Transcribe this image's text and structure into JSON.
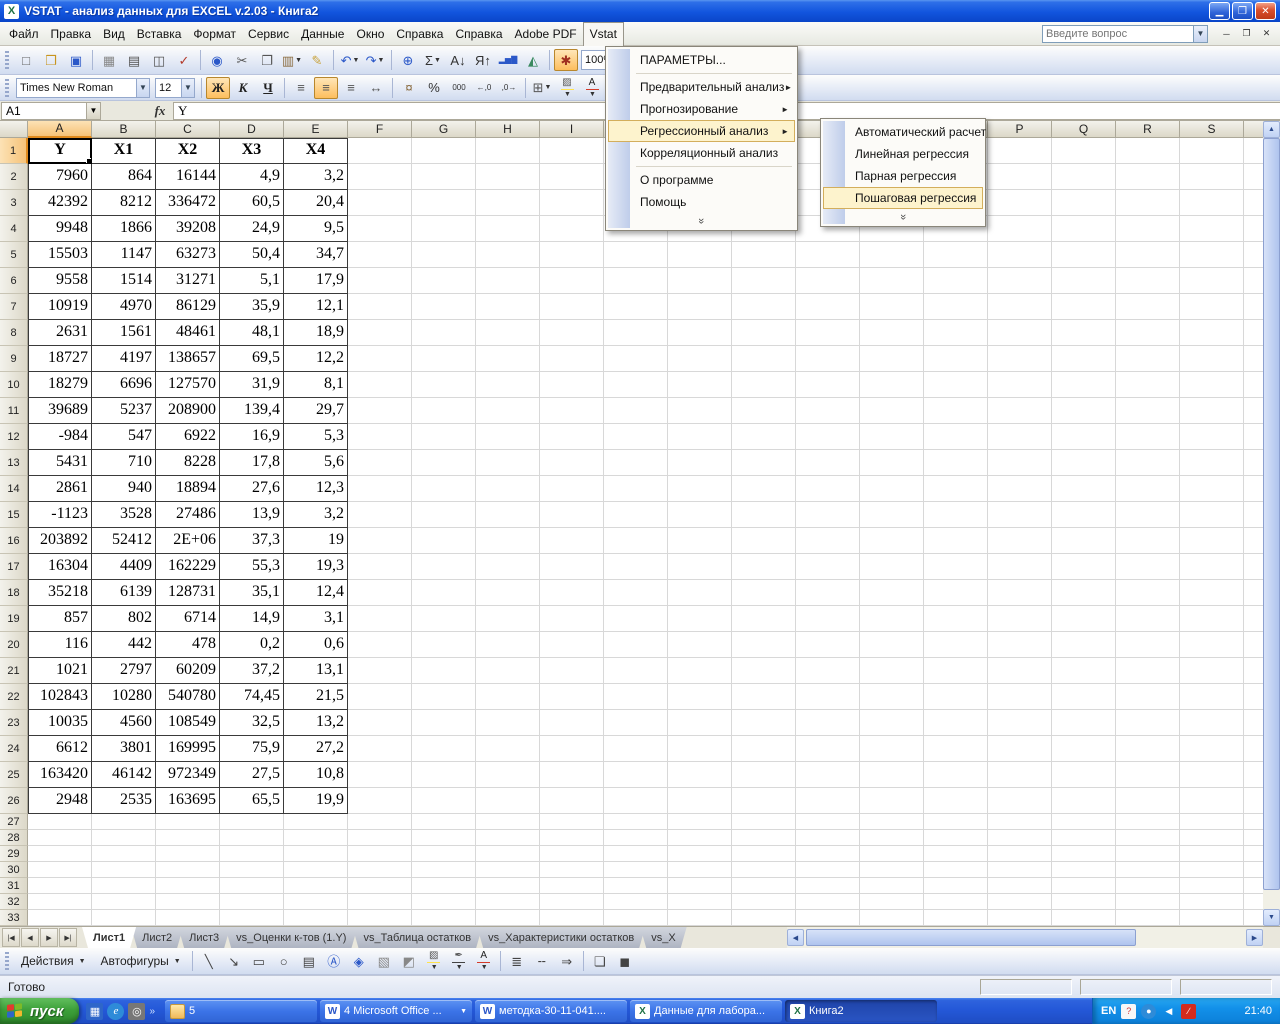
{
  "window": {
    "title": "VSTAT - анализ данных для EXCEL v.2.03 - Книга2"
  },
  "colors": {
    "titlebar_blue": "#1255DE",
    "taskbar_blue": "#2458D8",
    "start_green": "#3DA03A",
    "selection_orange": "#F6C278",
    "menu_highlight": "#FDF3CD",
    "toolbar_blue": "#D1DCF0"
  },
  "menu_bar": {
    "items": [
      "Файл",
      "Правка",
      "Вид",
      "Вставка",
      "Формат",
      "Сервис",
      "Данные",
      "Окно",
      "Справка",
      "Справка",
      "Adobe PDF",
      "Vstat"
    ],
    "active_item": "Vstat",
    "question_box": "Введите вопрос",
    "doc_controls": [
      "─",
      "❐",
      "✕"
    ]
  },
  "standard_toolbar": {
    "zoom_value": "100%",
    "items": [
      {
        "type": "grip"
      },
      {
        "name": "new-document-icon",
        "glyph": "□",
        "color": "#666"
      },
      {
        "name": "open-icon",
        "glyph": "❒",
        "color": "#C8951F"
      },
      {
        "name": "save-icon",
        "glyph": "▣",
        "color": "#2B58C8"
      },
      {
        "type": "sep"
      },
      {
        "name": "permission-icon",
        "glyph": "▦",
        "color": "#888"
      },
      {
        "name": "print-icon",
        "glyph": "▤",
        "color": "#555"
      },
      {
        "name": "print-preview-icon",
        "glyph": "◫",
        "color": "#555"
      },
      {
        "name": "spelling-icon",
        "glyph": "✓",
        "color": "#B33A2B"
      },
      {
        "type": "sep"
      },
      {
        "name": "research-icon",
        "glyph": "◉",
        "color": "#2B58C8"
      },
      {
        "name": "cut-icon",
        "glyph": "✂",
        "color": "#555"
      },
      {
        "name": "copy-icon",
        "glyph": "❐",
        "color": "#555"
      },
      {
        "name": "paste-icon",
        "glyph": "▥",
        "color": "#8A6B3F",
        "dropdown": true
      },
      {
        "name": "format-painter-icon",
        "glyph": "✎",
        "color": "#C8A23A"
      },
      {
        "type": "sep"
      },
      {
        "name": "undo-icon",
        "glyph": "↶",
        "color": "#2B58C8",
        "dropdown": true
      },
      {
        "name": "redo-icon",
        "glyph": "↷",
        "color": "#2B58C8",
        "dropdown": true
      },
      {
        "type": "sep"
      },
      {
        "name": "hyperlink-icon",
        "glyph": "⊕",
        "color": "#2B58C8"
      },
      {
        "name": "autosum-icon",
        "glyph": "Σ",
        "color": "#333",
        "dropdown": true
      },
      {
        "name": "sort-ascending-icon",
        "glyph": "А↓",
        "color": "#333"
      },
      {
        "name": "sort-descending-icon",
        "glyph": "Я↑",
        "color": "#333"
      },
      {
        "name": "chart-wizard-icon",
        "glyph": "▂▅▇",
        "color": "#2B58C8"
      },
      {
        "name": "drawing-icon",
        "glyph": "◭",
        "color": "#3A8A5F"
      },
      {
        "type": "sep"
      },
      {
        "name": "vstat-icon",
        "glyph": "✱",
        "color": "#A03020",
        "active": true
      },
      {
        "type": "zoom-combo"
      }
    ]
  },
  "formatting_toolbar": {
    "font_name": "Times New Roman",
    "font_size": "12",
    "items": [
      {
        "type": "grip"
      },
      {
        "type": "font-combo"
      },
      {
        "type": "size-combo"
      },
      {
        "type": "sep"
      },
      {
        "name": "bold-button",
        "glyph": "Ж",
        "color": "#222",
        "cls": "fmt-b",
        "active": true
      },
      {
        "name": "italic-button",
        "glyph": "К",
        "color": "#222",
        "cls": "fmt-i"
      },
      {
        "name": "underline-button",
        "glyph": "Ч",
        "color": "#222",
        "cls": "fmt-u"
      },
      {
        "type": "sep"
      },
      {
        "name": "align-left-icon",
        "glyph": "≡",
        "color": "#555"
      },
      {
        "name": "align-center-icon",
        "glyph": "≡",
        "color": "#555",
        "active": true
      },
      {
        "name": "align-right-icon",
        "glyph": "≡",
        "color": "#555"
      },
      {
        "name": "merge-center-icon",
        "glyph": "↔",
        "color": "#555"
      },
      {
        "type": "sep"
      },
      {
        "name": "currency-icon",
        "glyph": "¤",
        "color": "#8A6B3F"
      },
      {
        "name": "percent-icon",
        "glyph": "%",
        "color": "#333"
      },
      {
        "name": "comma-style-icon",
        "glyph": "000",
        "color": "#333"
      },
      {
        "name": "increase-decimal-icon",
        "glyph": "←,0",
        "color": "#333"
      },
      {
        "name": "decrease-decimal-icon",
        "glyph": ",0→",
        "color": "#333"
      },
      {
        "type": "sep"
      },
      {
        "name": "borders-icon",
        "glyph": "⊞",
        "color": "#555",
        "dropdown": true
      },
      {
        "name": "fill-color-icon",
        "glyph": "▨",
        "color": "#555",
        "strip": "#FFE34D",
        "dropdown": true
      },
      {
        "name": "font-color-icon",
        "glyph": "А",
        "color": "#222",
        "strip": "#D43B2A",
        "dropdown": true
      }
    ]
  },
  "formula_bar": {
    "name_box": "A1",
    "fx_label": "fx",
    "content": "Y"
  },
  "vstat_menu": {
    "title": "Vstat",
    "items": [
      {
        "label": "ПАРАМЕТРЫ...",
        "type": "item"
      },
      {
        "type": "separator"
      },
      {
        "label": "Предварительный анализ",
        "type": "item",
        "has_submenu": true
      },
      {
        "label": "Прогнозирование",
        "type": "item",
        "has_submenu": true
      },
      {
        "label": "Регрессионный анализ",
        "type": "item",
        "has_submenu": true,
        "highlighted": true
      },
      {
        "label": "Корреляционный анализ",
        "type": "item"
      },
      {
        "type": "separator"
      },
      {
        "label": "О программе",
        "type": "item"
      },
      {
        "label": "Помощь",
        "type": "item"
      },
      {
        "type": "chevron"
      }
    ]
  },
  "regression_submenu": {
    "items": [
      {
        "label": "Автоматический расчет",
        "type": "item"
      },
      {
        "label": "Линейная регрессия",
        "type": "item"
      },
      {
        "label": "Парная регрессия",
        "type": "item"
      },
      {
        "label": "Пошаговая регрессия",
        "type": "item",
        "highlighted": true
      },
      {
        "type": "chevron"
      }
    ]
  },
  "grid": {
    "columns": [
      "A",
      "B",
      "C",
      "D",
      "E",
      "F",
      "G",
      "H",
      "I",
      "J",
      "K",
      "L",
      "M",
      "N",
      "O",
      "P",
      "Q",
      "R",
      "S"
    ],
    "visible_rows": 33,
    "active_cell": "A1",
    "selected_column": "A",
    "selected_row": "1"
  },
  "table": {
    "range": "A1:E26",
    "headers": [
      "Y",
      "X1",
      "X2",
      "X3",
      "X4"
    ],
    "rows": [
      [
        "Y",
        "X1",
        "X2",
        "X3",
        "X4"
      ],
      [
        "7960",
        "864",
        "16144",
        "4,9",
        "3,2"
      ],
      [
        "42392",
        "8212",
        "336472",
        "60,5",
        "20,4"
      ],
      [
        "9948",
        "1866",
        "39208",
        "24,9",
        "9,5"
      ],
      [
        "15503",
        "1147",
        "63273",
        "50,4",
        "34,7"
      ],
      [
        "9558",
        "1514",
        "31271",
        "5,1",
        "17,9"
      ],
      [
        "10919",
        "4970",
        "86129",
        "35,9",
        "12,1"
      ],
      [
        "2631",
        "1561",
        "48461",
        "48,1",
        "18,9"
      ],
      [
        "18727",
        "4197",
        "138657",
        "69,5",
        "12,2"
      ],
      [
        "18279",
        "6696",
        "127570",
        "31,9",
        "8,1"
      ],
      [
        "39689",
        "5237",
        "208900",
        "139,4",
        "29,7"
      ],
      [
        "-984",
        "547",
        "6922",
        "16,9",
        "5,3"
      ],
      [
        "5431",
        "710",
        "8228",
        "17,8",
        "5,6"
      ],
      [
        "2861",
        "940",
        "18894",
        "27,6",
        "12,3"
      ],
      [
        "-1123",
        "3528",
        "27486",
        "13,9",
        "3,2"
      ],
      [
        "203892",
        "52412",
        "2E+06",
        "37,3",
        "19"
      ],
      [
        "16304",
        "4409",
        "162229",
        "55,3",
        "19,3"
      ],
      [
        "35218",
        "6139",
        "128731",
        "35,1",
        "12,4"
      ],
      [
        "857",
        "802",
        "6714",
        "14,9",
        "3,1"
      ],
      [
        "116",
        "442",
        "478",
        "0,2",
        "0,6"
      ],
      [
        "1021",
        "2797",
        "60209",
        "37,2",
        "13,1"
      ],
      [
        "102843",
        "10280",
        "540780",
        "74,45",
        "21,5"
      ],
      [
        "10035",
        "4560",
        "108549",
        "32,5",
        "13,2"
      ],
      [
        "6612",
        "3801",
        "169995",
        "75,9",
        "27,2"
      ],
      [
        "163420",
        "46142",
        "972349",
        "27,5",
        "10,8"
      ],
      [
        "2948",
        "2535",
        "163695",
        "65,5",
        "19,9"
      ]
    ]
  },
  "sheet_tabs": {
    "nav": [
      "|◀",
      "◀",
      "▶",
      "▶|"
    ],
    "tabs": [
      "Лист1",
      "Лист2",
      "Лист3",
      "vs_Оценки к-тов (1.Y)",
      "vs_Таблица остатков",
      "vs_Характеристики остатков",
      "vs_X"
    ],
    "active": "Лист1"
  },
  "drawing_toolbar": {
    "actions_label": "Действия",
    "autoshapes_label": "Автофигуры",
    "items": [
      {
        "type": "grip"
      },
      {
        "type": "menu-btn",
        "name": "actions-button",
        "bind": "actions_label"
      },
      {
        "type": "menu-btn",
        "name": "autoshapes-button",
        "bind": "autoshapes_label"
      },
      {
        "type": "sep"
      },
      {
        "name": "line-icon",
        "glyph": "╲",
        "color": "#444"
      },
      {
        "name": "arrow-icon",
        "glyph": "↘",
        "color": "#444"
      },
      {
        "name": "rectangle-icon",
        "glyph": "▭",
        "color": "#444"
      },
      {
        "name": "oval-icon",
        "glyph": "○",
        "color": "#444"
      },
      {
        "name": "textbox-icon",
        "glyph": "▤",
        "color": "#444"
      },
      {
        "name": "wordart-icon",
        "glyph": "Ⓐ",
        "color": "#2B58C8"
      },
      {
        "name": "diagram-icon",
        "glyph": "◈",
        "color": "#2B58C8"
      },
      {
        "name": "clipart-icon",
        "glyph": "▧",
        "color": "#888"
      },
      {
        "name": "picture-icon",
        "glyph": "◩",
        "color": "#888"
      },
      {
        "name": "fill-color-icon",
        "glyph": "▨",
        "color": "#555",
        "strip": "#FFE34D",
        "dropdown": true
      },
      {
        "name": "line-color-icon",
        "glyph": "✒",
        "color": "#555",
        "strip": "#444444",
        "dropdown": true
      },
      {
        "name": "font-color-icon",
        "glyph": "А",
        "color": "#222",
        "strip": "#D43B2A",
        "dropdown": true
      },
      {
        "type": "sep"
      },
      {
        "name": "line-style-icon",
        "glyph": "≣",
        "color": "#444"
      },
      {
        "name": "dash-style-icon",
        "glyph": "╌",
        "color": "#444"
      },
      {
        "name": "arrow-style-icon",
        "glyph": "⇒",
        "color": "#444"
      },
      {
        "type": "sep"
      },
      {
        "name": "shadow-icon",
        "glyph": "❏",
        "color": "#444"
      },
      {
        "name": "threed-icon",
        "glyph": "◼",
        "color": "#444"
      }
    ]
  },
  "status_bar": {
    "mode": "Готово"
  },
  "taskbar": {
    "start_label": "пуск",
    "buttons": [
      {
        "label": "5",
        "icon": "folder"
      },
      {
        "label": "4 Microsoft Office ...",
        "icon": "word",
        "group": true
      },
      {
        "label": "методка-30-11-041....",
        "icon": "word"
      },
      {
        "label": "Данные для лабора...",
        "icon": "excel"
      },
      {
        "label": "Книга2",
        "icon": "excel",
        "active": true
      }
    ],
    "tray": {
      "language": "EN",
      "time": "21:40"
    }
  }
}
